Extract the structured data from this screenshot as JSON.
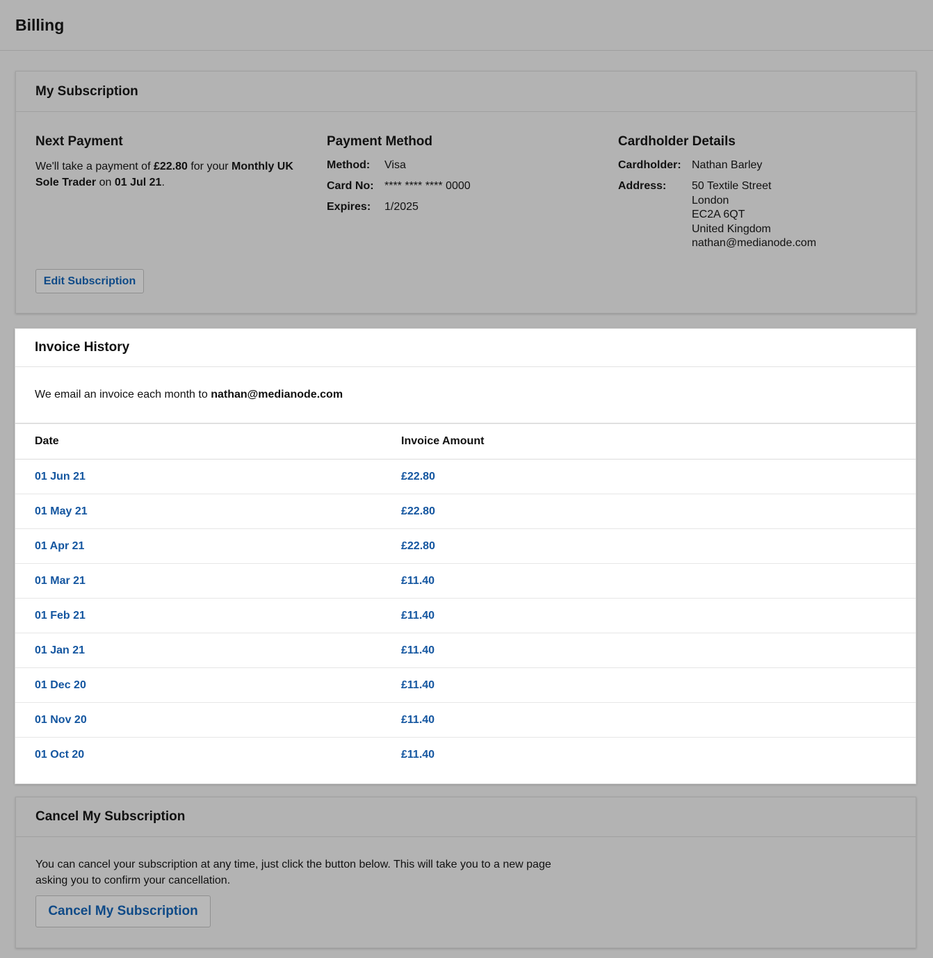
{
  "page": {
    "title": "Billing"
  },
  "subscription": {
    "title": "My Subscription",
    "next_payment": {
      "heading": "Next Payment",
      "text1": "We'll take a payment of ",
      "amount": "£22.80",
      "text2": " for your ",
      "plan": "Monthly UK Sole Trader",
      "text3": " on ",
      "date": "01 Jul 21",
      "text4": "."
    },
    "payment_method": {
      "heading": "Payment Method",
      "method_label": "Method:",
      "method_value": "Visa",
      "card_label": "Card No:",
      "card_value": "**** **** **** 0000",
      "expires_label": "Expires:",
      "expires_value": "1/2025"
    },
    "cardholder": {
      "heading": "Cardholder Details",
      "name_label": "Cardholder:",
      "name_value": "Nathan Barley",
      "address_label": "Address:",
      "address_lines": [
        "50 Textile Street",
        "London",
        "EC2A 6QT",
        "United Kingdom",
        "nathan@medianode.com"
      ]
    },
    "edit_label": "Edit Subscription"
  },
  "invoices": {
    "title": "Invoice History",
    "intro_text": "We email an invoice each month to ",
    "intro_email": "nathan@medianode.com",
    "col_date": "Date",
    "col_amount": "Invoice Amount",
    "rows": [
      {
        "date": "01 Jun 21",
        "amount": "£22.80"
      },
      {
        "date": "01 May 21",
        "amount": "£22.80"
      },
      {
        "date": "01 Apr 21",
        "amount": "£22.80"
      },
      {
        "date": "01 Mar 21",
        "amount": "£11.40"
      },
      {
        "date": "01 Feb 21",
        "amount": "£11.40"
      },
      {
        "date": "01 Jan 21",
        "amount": "£11.40"
      },
      {
        "date": "01 Dec 20",
        "amount": "£11.40"
      },
      {
        "date": "01 Nov 20",
        "amount": "£11.40"
      },
      {
        "date": "01 Oct 20",
        "amount": "£11.40"
      }
    ]
  },
  "cancel": {
    "title": "Cancel My Subscription",
    "text": "You can cancel your subscription at any time, just click the button below. This will take you to a new page asking you to confirm your cancellation.",
    "button_label": "Cancel My Subscription"
  },
  "colors": {
    "background": "#b3b3b3",
    "link": "#1456a0",
    "button_text": "#0f4a87"
  }
}
